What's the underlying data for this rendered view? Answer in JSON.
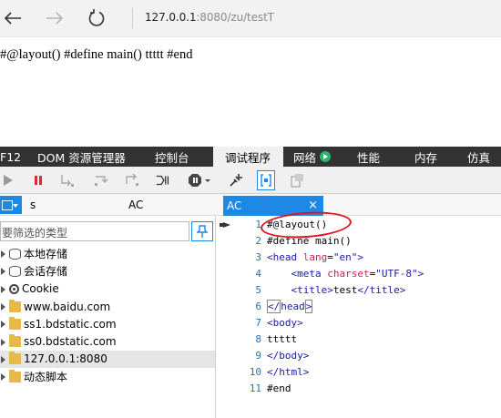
{
  "browser": {
    "address_host": "127.0.0.1",
    "address_path": ":8080/zu/testT",
    "icons": [
      "back-arrow-icon",
      "forward-arrow-icon",
      "refresh-icon"
    ]
  },
  "page": {
    "text": "#@layout() #define main() ttttt #end"
  },
  "devtools": {
    "tabs": [
      "F12",
      "DOM 资源管理器",
      "控制台",
      "调试程序",
      "网络",
      "性能",
      "内存",
      "仿真"
    ],
    "active_tab": "调试程序"
  },
  "left_panel": {
    "tab_s": "s",
    "tab_ac": "AC",
    "filter_placeholder": "要筛选的类型",
    "tree": [
      {
        "label": "本地存储",
        "icon": "database-icon"
      },
      {
        "label": "会话存储",
        "icon": "database-icon"
      },
      {
        "label": "Cookie",
        "icon": "cookie-gear-icon"
      },
      {
        "label": "www.baidu.com",
        "icon": "folder-icon"
      },
      {
        "label": "ss1.bdstatic.com",
        "icon": "folder-icon"
      },
      {
        "label": "ss0.bdstatic.com",
        "icon": "folder-icon"
      },
      {
        "label": "127.0.0.1:8080",
        "icon": "folder-icon",
        "selected": true
      },
      {
        "label": "动态脚本",
        "icon": "folder-icon"
      }
    ]
  },
  "editor": {
    "tab_label": "AC",
    "close_glyph": "×",
    "lines": [
      {
        "n": "1",
        "parts": [
          {
            "t": "#@layout()",
            "c": "txt"
          }
        ]
      },
      {
        "n": "2",
        "parts": [
          {
            "t": "#define main()",
            "c": "txt"
          }
        ]
      },
      {
        "n": "3",
        "parts": [
          {
            "t": "<head ",
            "c": "c-tag"
          },
          {
            "t": "lang",
            "c": "c-attr"
          },
          {
            "t": "=",
            "c": "txt"
          },
          {
            "t": "\"en\"",
            "c": "c-val"
          },
          {
            "t": ">",
            "c": "c-tag"
          }
        ]
      },
      {
        "n": "4",
        "parts": [
          {
            "t": "    <meta ",
            "c": "c-tag"
          },
          {
            "t": "charset",
            "c": "c-attr"
          },
          {
            "t": "=",
            "c": "txt"
          },
          {
            "t": "\"UTF-8\"",
            "c": "c-val"
          },
          {
            "t": ">",
            "c": "c-tag"
          }
        ]
      },
      {
        "n": "5",
        "parts": [
          {
            "t": "    <title>",
            "c": "c-tag"
          },
          {
            "t": "test",
            "c": "txt"
          },
          {
            "t": "</title>",
            "c": "c-tag"
          }
        ]
      },
      {
        "n": "6",
        "parts": [
          {
            "t": "</",
            "c": "c-tag bracket-hl"
          },
          {
            "t": "head",
            "c": "c-tag"
          },
          {
            "t": ">",
            "c": "c-tag bracket-hl"
          }
        ]
      },
      {
        "n": "7",
        "parts": [
          {
            "t": "<body>",
            "c": "c-tag"
          }
        ]
      },
      {
        "n": "8",
        "parts": [
          {
            "t": "ttttt",
            "c": "txt"
          }
        ]
      },
      {
        "n": "9",
        "parts": [
          {
            "t": "</body>",
            "c": "c-tag"
          }
        ]
      },
      {
        "n": "10",
        "parts": [
          {
            "t": "</html>",
            "c": "c-tag"
          }
        ]
      },
      {
        "n": "11",
        "parts": [
          {
            "t": "#end",
            "c": "txt"
          }
        ]
      }
    ]
  },
  "colors": {
    "accent": "#1e88e5",
    "devtools_bar": "#333333",
    "annotation": "#e0141e"
  }
}
